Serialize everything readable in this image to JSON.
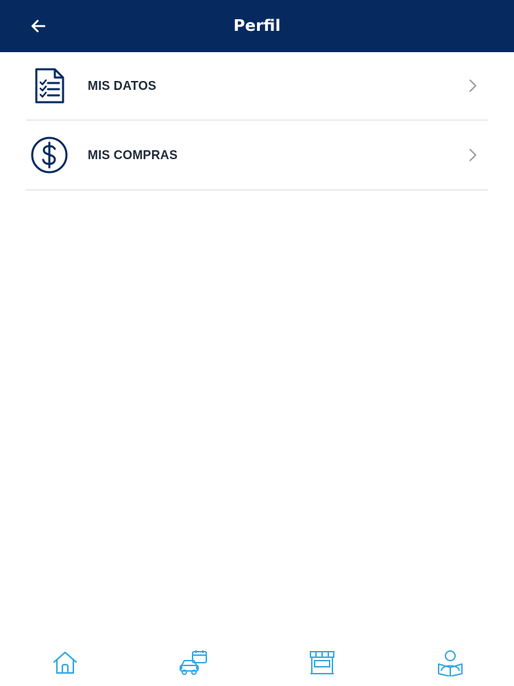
{
  "header": {
    "title": "Perfil",
    "back_icon": "arrow-left-icon",
    "background": "#062a5f"
  },
  "menu": {
    "items": [
      {
        "label": "MIS DATOS",
        "icon": "document-checklist-icon"
      },
      {
        "label": "MIS COMPRAS",
        "icon": "dollar-circle-icon"
      }
    ]
  },
  "bottom_nav": {
    "items": [
      {
        "icon": "home-icon"
      },
      {
        "icon": "car-calendar-icon"
      },
      {
        "icon": "store-icon"
      },
      {
        "icon": "person-book-icon"
      }
    ],
    "accent": "#34a7e0"
  },
  "colors": {
    "primary": "#062a5f",
    "text": "#1f2a3a",
    "divider": "#e8e8e8",
    "chevron": "#9a9a9a"
  }
}
